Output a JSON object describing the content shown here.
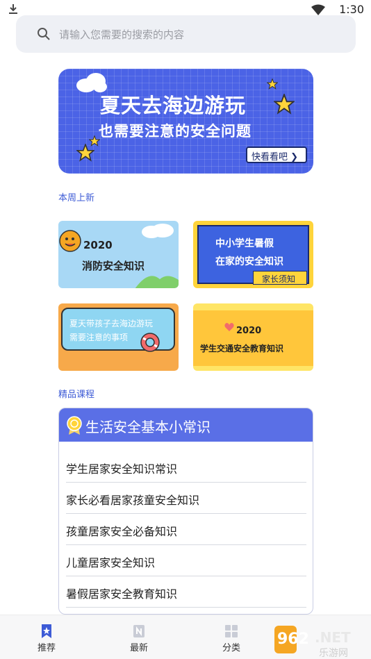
{
  "status_bar": {
    "time": "1:30"
  },
  "search": {
    "placeholder": "请输入您需要的搜索的内容"
  },
  "banner": {
    "title": "夏天去海边游玩",
    "subtitle": "也需要注意的安全问题",
    "button": "快看看吧 ❯"
  },
  "sections": {
    "weekly_new": "本周上新",
    "featured": "精品课程"
  },
  "cards": [
    {
      "year": "2020",
      "title": "消防安全知识"
    },
    {
      "line1": "中小学生暑假",
      "line2": "在家的安全知识",
      "tag": "家长须知"
    },
    {
      "line1": "夏天带孩子去海边游玩",
      "line2": "需要注意的事项"
    },
    {
      "year": "2020",
      "title": "学生交通安全教育知识"
    }
  ],
  "course": {
    "title": "生活安全基本小常识",
    "items": [
      "学生居家安全知识常识",
      "家长必看居家孩童安全知识",
      "孩童居家安全必备知识",
      "儿童居家安全知识",
      "暑假居家安全教育知识"
    ]
  },
  "tabs": [
    {
      "label": "推荐",
      "icon": "bookmark-icon"
    },
    {
      "label": "最新",
      "icon": "new-icon"
    },
    {
      "label": "分类",
      "icon": "grid-icon"
    }
  ],
  "watermark": {
    "brand": "962.NET",
    "sub": "乐游网"
  },
  "colors": {
    "accent": "#4b63e6",
    "label_blue": "#3d5bd6",
    "card_yellow": "#ffd43b"
  }
}
